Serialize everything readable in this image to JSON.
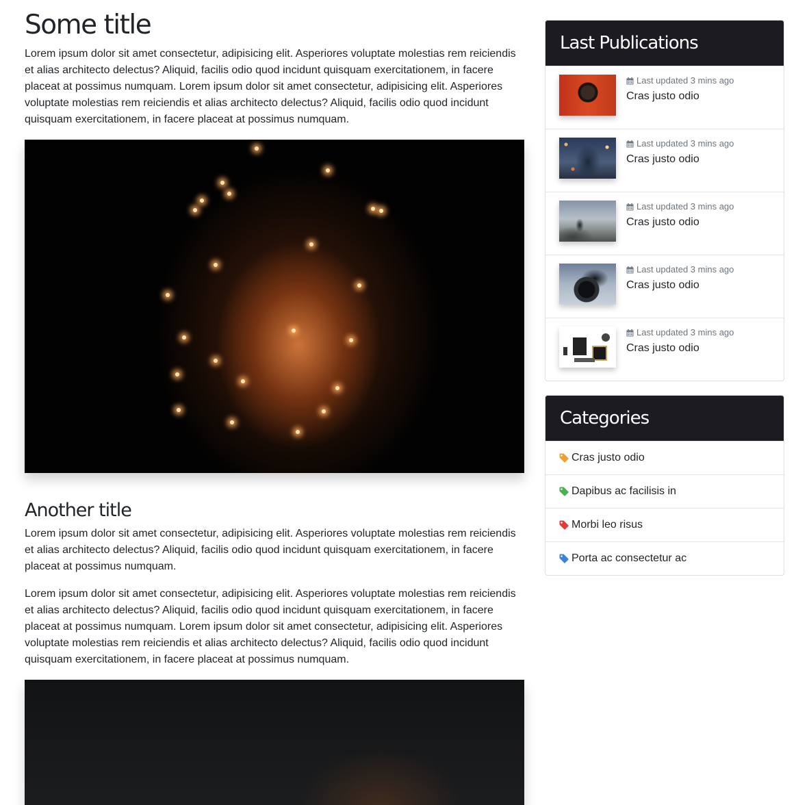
{
  "article": {
    "title_1": "Some title",
    "paragraph_1": "Lorem ipsum dolor sit amet consectetur, adipisicing elit. Asperiores voluptate molestias rem reiciendis et alias architecto delectus? Aliquid, facilis odio quod incidunt quisquam exercitationem, in facere placeat at possimus numquam. Lorem ipsum dolor sit amet consectetur, adipisicing elit. Asperiores voluptate molestias rem reiciendis et alias architecto delectus? Aliquid, facilis odio quod incidunt quisquam exercitationem, in facere placeat at possimus numquam.",
    "title_2": "Another title",
    "paragraph_2": "Lorem ipsum dolor sit amet consectetur, adipisicing elit. Asperiores voluptate molestias rem reiciendis et alias architecto delectus? Aliquid, facilis odio quod incidunt quisquam exercitationem, in facere placeat at possimus numquam.",
    "paragraph_3": "Lorem ipsum dolor sit amet consectetur, adipisicing elit. Asperiores voluptate molestias rem reiciendis et alias architecto delectus? Aliquid, facilis odio quod incidunt quisquam exercitationem, in facere placeat at possimus numquam. Lorem ipsum dolor sit amet consectetur, adipisicing elit. Asperiores voluptate molestias rem reiciendis et alias architecto delectus? Aliquid, facilis odio quod incidunt quisquam exercitationem, in facere placeat at possimus numquam."
  },
  "sidebar": {
    "publications": {
      "heading": "Last Publications",
      "meta_icon": "calendar-icon",
      "items": [
        {
          "meta": "Last updated 3 mins ago",
          "title": "Cras justo odio"
        },
        {
          "meta": "Last updated 3 mins ago",
          "title": "Cras justo odio"
        },
        {
          "meta": "Last updated 3 mins ago",
          "title": "Cras justo odio"
        },
        {
          "meta": "Last updated 3 mins ago",
          "title": "Cras justo odio"
        },
        {
          "meta": "Last updated 3 mins ago",
          "title": "Cras justo odio"
        }
      ]
    },
    "categories": {
      "heading": "Categories",
      "tag_icon": "tag-icon",
      "items": [
        {
          "label": "Cras justo odio",
          "color": "#f0a030"
        },
        {
          "label": "Dapibus ac facilisis in",
          "color": "#4caf50"
        },
        {
          "label": "Morbi leo risus",
          "color": "#e53935"
        },
        {
          "label": "Porta ac consectetur ac",
          "color": "#3b82d6"
        }
      ]
    }
  },
  "colors": {
    "header_bg": "#1c1b21",
    "text": "#212529",
    "muted": "#6c757d"
  }
}
